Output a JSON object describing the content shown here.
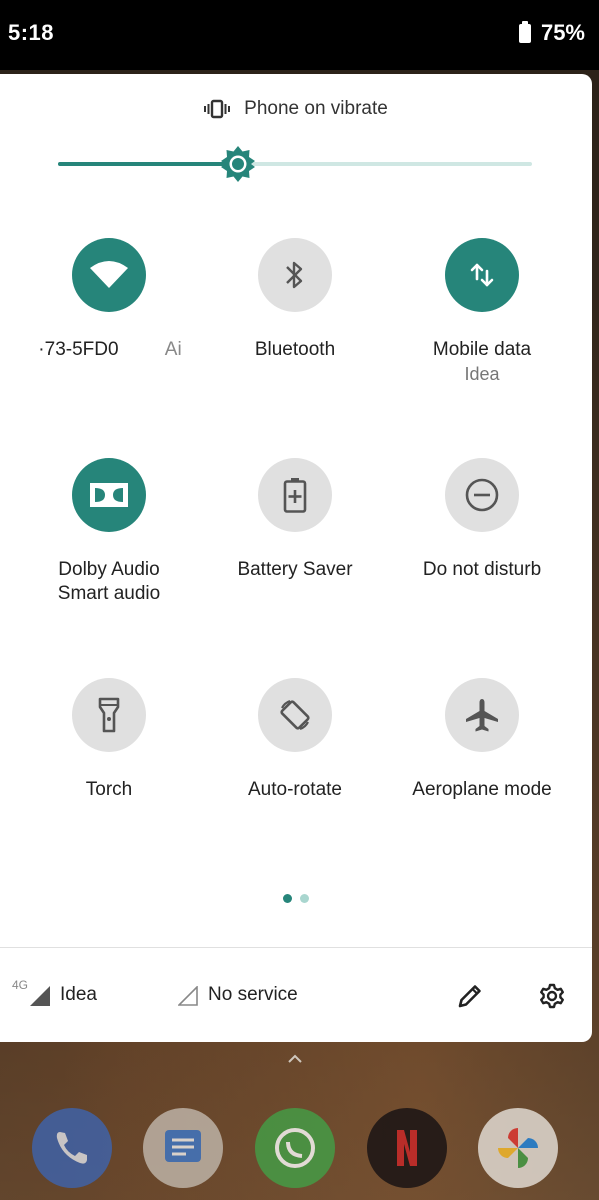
{
  "status_bar": {
    "time": "5:18",
    "battery": "75%"
  },
  "ringer": {
    "label": "Phone on vibrate"
  },
  "brightness": {
    "level_fraction": 0.38
  },
  "tiles": [
    {
      "name": "tile-wifi",
      "icon": "wifi-icon",
      "label": "·73-5FD0",
      "label_extra": "Ai",
      "sublabel": "",
      "state": "on"
    },
    {
      "name": "tile-bluetooth",
      "icon": "bluetooth-icon",
      "label": "Bluetooth",
      "sublabel": "",
      "state": "off"
    },
    {
      "name": "tile-mobile-data",
      "icon": "mobile-data-icon",
      "label": "Mobile data",
      "sublabel": "Idea",
      "state": "on"
    },
    {
      "name": "tile-dolby",
      "icon": "dolby-icon",
      "label": "Dolby Audio",
      "sublabel": "Smart audio",
      "state": "on"
    },
    {
      "name": "tile-battery-saver",
      "icon": "battery-saver-icon",
      "label": "Battery Saver",
      "sublabel": "",
      "state": "off"
    },
    {
      "name": "tile-dnd",
      "icon": "do-not-disturb-icon",
      "label": "Do not disturb",
      "sublabel": "",
      "state": "off"
    },
    {
      "name": "tile-torch",
      "icon": "torch-icon",
      "label": "Torch",
      "sublabel": "",
      "state": "off"
    },
    {
      "name": "tile-auto-rotate",
      "icon": "auto-rotate-icon",
      "label": "Auto-rotate",
      "sublabel": "",
      "state": "off"
    },
    {
      "name": "tile-aeroplane",
      "icon": "aeroplane-icon",
      "label": "Aeroplane mode",
      "sublabel": "",
      "state": "off"
    }
  ],
  "pager": {
    "pages": 2,
    "current": 1
  },
  "footer": {
    "sim1": {
      "network_type": "4G",
      "carrier": "Idea"
    },
    "sim2": {
      "carrier": "No service"
    }
  },
  "colors": {
    "accent": "#26857a",
    "accent_light": "#cfe7e3",
    "tile_off": "#e0e0e0"
  }
}
